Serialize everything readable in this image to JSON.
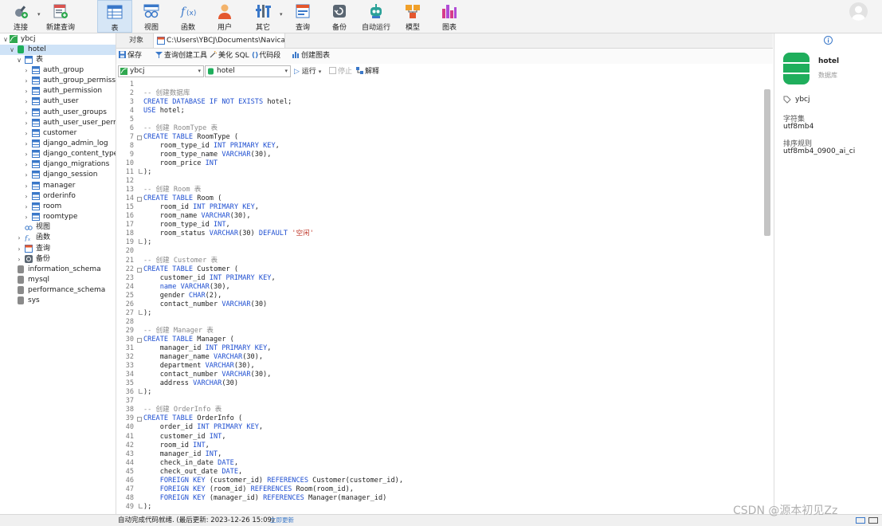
{
  "toolbar": {
    "connect": "连接",
    "new_query": "新建查询",
    "table": "表",
    "view": "视图",
    "function": "函数",
    "user": "用户",
    "other": "其它",
    "query": "查询",
    "backup": "备份",
    "automation": "自动运行",
    "model": "模型",
    "chart": "图表"
  },
  "sidebar": {
    "connection": "ybcj",
    "database": "hotel",
    "tables_node": "表",
    "tables": [
      "auth_group",
      "auth_group_permission",
      "auth_permission",
      "auth_user",
      "auth_user_groups",
      "auth_user_user_permis",
      "customer",
      "django_admin_log",
      "django_content_type",
      "django_migrations",
      "django_session",
      "manager",
      "orderinfo",
      "room",
      "roomtype"
    ],
    "views_node": "视图",
    "functions_node": "函数",
    "queries_node": "查询",
    "backups_node": "备份",
    "other_dbs": [
      "information_schema",
      "mysql",
      "performance_schema",
      "sys"
    ]
  },
  "tabs": {
    "objects": "对象",
    "query_tab": "C:\\Users\\YBCJ\\Documents\\Navicat\\..."
  },
  "editor_toolbar": {
    "save": "保存",
    "query_builder": "查询创建工具",
    "beautify": "美化 SQL",
    "snippet": "代码段",
    "create_chart": "创建图表",
    "run": "运行",
    "stop": "停止",
    "explain": "解释"
  },
  "selectors": {
    "connection": "ybcj",
    "database": "hotel"
  },
  "code_lines": [
    "",
    "-- 创建数据库",
    "CREATE DATABASE IF NOT EXISTS hotel;",
    "USE hotel;",
    "",
    "-- 创建 RoomType 表",
    "CREATE TABLE RoomType (",
    "    room_type_id INT PRIMARY KEY,",
    "    room_type_name VARCHAR(30),",
    "    room_price INT",
    ");",
    "",
    "-- 创建 Room 表",
    "CREATE TABLE Room (",
    "    room_id INT PRIMARY KEY,",
    "    room_name VARCHAR(30),",
    "    room_type_id INT,",
    "    room_status VARCHAR(30) DEFAULT '空闲'",
    ");",
    "",
    "-- 创建 Customer 表",
    "CREATE TABLE Customer (",
    "    customer_id INT PRIMARY KEY,",
    "    name VARCHAR(30),",
    "    gender CHAR(2),",
    "    contact_number VARCHAR(30)",
    ");",
    "",
    "-- 创建 Manager 表",
    "CREATE TABLE Manager (",
    "    manager_id INT PRIMARY KEY,",
    "    manager_name VARCHAR(30),",
    "    department VARCHAR(30),",
    "    contact_number VARCHAR(30),",
    "    address VARCHAR(30)",
    ");",
    "",
    "-- 创建 OrderInfo 表",
    "CREATE TABLE OrderInfo (",
    "    order_id INT PRIMARY KEY,",
    "    customer_id INT,",
    "    room_id INT,",
    "    manager_id INT,",
    "    check_in_date DATE,",
    "    check_out_date DATE,",
    "    FOREIGN KEY (customer_id) REFERENCES Customer(customer_id),",
    "    FOREIGN KEY (room_id) REFERENCES Room(room_id),",
    "    FOREIGN KEY (manager_id) REFERENCES Manager(manager_id)",
    ");"
  ],
  "right_panel": {
    "db_name": "hotel",
    "db_type": "数据库",
    "connection": "ybcj",
    "charset_label": "字符集",
    "charset": "utf8mb4",
    "collation_label": "排序规则",
    "collation": "utf8mb4_0900_ai_ci"
  },
  "status": {
    "message": "自动完成代码就绪. (最后更新: 2023-12-26 15:09)",
    "update_link": "立即更新"
  },
  "watermark": "CSDN @源本初见Zz",
  "colors": {
    "keyword": "#1f4fd1",
    "comment": "#8a8a8a",
    "string": "#c0392b",
    "db_green": "#1fae5c"
  }
}
